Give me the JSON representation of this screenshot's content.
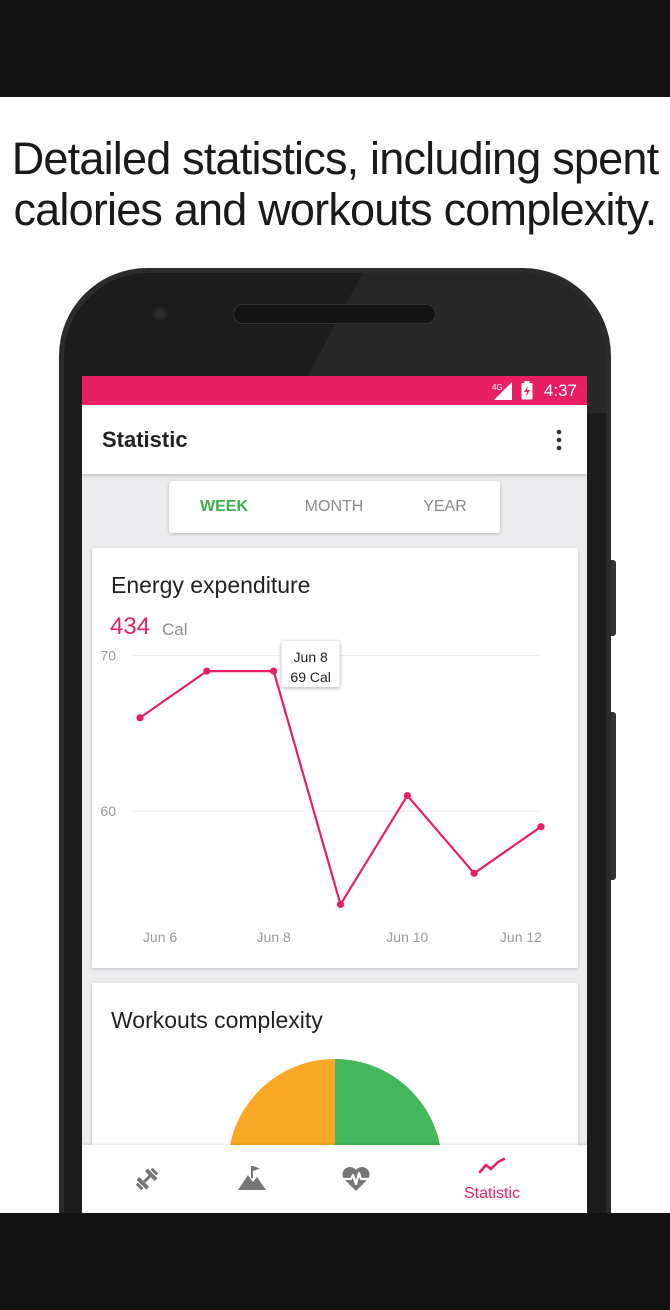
{
  "headline": {
    "line1": "Detailed statistics, including spent",
    "line2": "calories and workouts complexity."
  },
  "status_bar": {
    "time": "4:37",
    "network": "4G",
    "color": "#ea1e63"
  },
  "app_bar": {
    "title": "Statistic",
    "menu_icon": "more-vert-icon"
  },
  "period_tabs": {
    "items": [
      "WEEK",
      "MONTH",
      "YEAR"
    ],
    "selected": "WEEK"
  },
  "energy_card": {
    "title": "Energy expenditure",
    "value": "434",
    "unit": "Cal",
    "tooltip": {
      "date": "Jun 8",
      "value": "69 Cal"
    }
  },
  "chart_data": {
    "type": "line",
    "title": "Energy expenditure",
    "x": [
      0,
      1,
      2,
      3,
      4,
      5,
      6
    ],
    "x_tick_labels": [
      {
        "x": 0.3,
        "label": "Jun 6"
      },
      {
        "x": 2,
        "label": "Jun 8"
      },
      {
        "x": 4,
        "label": "Jun 10"
      },
      {
        "x": 5.7,
        "label": "Jun 12"
      }
    ],
    "series": [
      {
        "values": [
          66,
          69,
          69,
          54,
          61,
          56,
          59
        ],
        "color": "#e91e63"
      }
    ],
    "y_ticks": [
      60,
      70
    ],
    "ylim": [
      53,
      71
    ],
    "xlim": [
      0,
      6
    ],
    "grid": true
  },
  "workouts_card": {
    "title": "Workouts complexity",
    "colors": [
      "#f9a825",
      "#43b75a"
    ]
  },
  "bottom_nav": {
    "items": [
      {
        "icon": "dumbbell-icon",
        "label": ""
      },
      {
        "icon": "mountain-flag-icon",
        "label": ""
      },
      {
        "icon": "heartbeat-icon",
        "label": ""
      },
      {
        "icon": "trending-line-icon",
        "label": "Statistic"
      }
    ],
    "active_color": "#e91e63"
  }
}
